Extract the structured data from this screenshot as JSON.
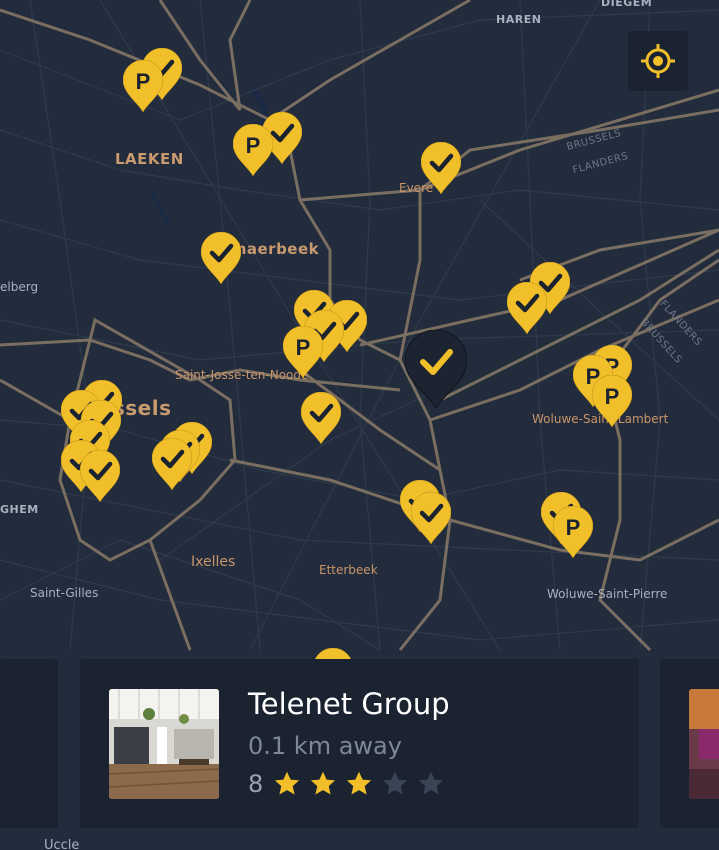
{
  "map": {
    "places": {
      "laeken": "LAEKEN",
      "schaerbeek": "Schaerbeek",
      "evere": "Evere",
      "saint_josse": "Saint-Josse-ten-Noode",
      "brussels": "Brussels",
      "woluwe_sl": "Woluwe-Saint-Lambert",
      "ixelles": "Ixelles",
      "etterbeek": "Etterbeek",
      "saint_gilles": "Saint-Gilles",
      "woluwe_sp": "Woluwe-Saint-Pierre",
      "haren": "HAREN",
      "diegem": "DIEGEM",
      "koekelberg": "elberg",
      "anderlecht": "GHEM",
      "brussels_road": "BRUSSELS",
      "flanders_road": "FLANDERS",
      "flanders_road2": "FLANDERS",
      "brussels_road2": "BRUSSELS",
      "uccle": "Uccle"
    },
    "colors": {
      "pin": "#f1bf2a",
      "pin_dark": "#1c2431",
      "road": "#8a7a68",
      "bg": "#222c3c"
    }
  },
  "locate_button": {
    "icon": "crosshair-icon"
  },
  "cards": {
    "main": {
      "title": "Telenet Group",
      "distance": "0.1 km away",
      "rating_value": "8",
      "rating_stars": 3,
      "rating_max": 5
    }
  }
}
